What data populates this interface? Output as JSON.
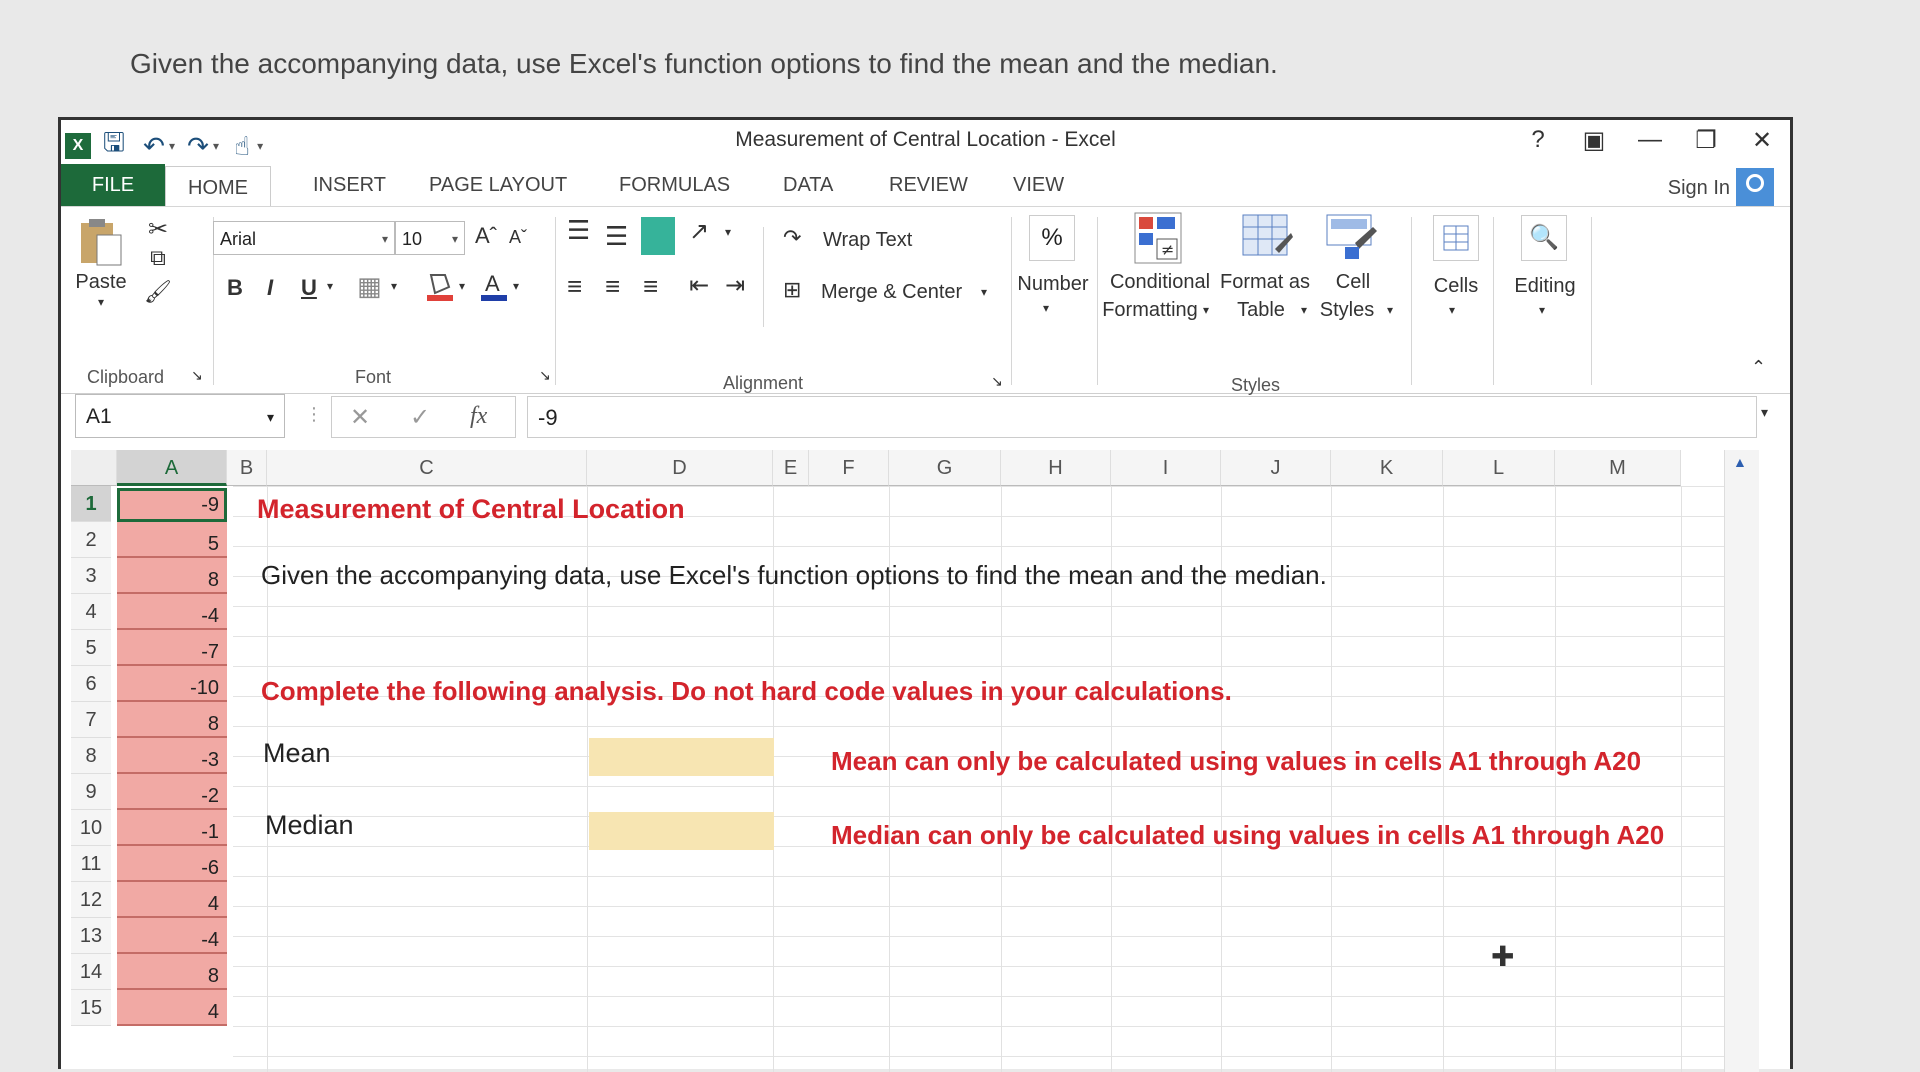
{
  "question": "Given the accompanying data, use Excel's function options to find the mean and the median.",
  "window": {
    "title": "Measurement of Central Location - Excel",
    "help": "?",
    "sign_in": "Sign In"
  },
  "tabs": [
    "FILE",
    "HOME",
    "INSERT",
    "PAGE LAYOUT",
    "FORMULAS",
    "DATA",
    "REVIEW",
    "VIEW"
  ],
  "ribbon": {
    "clipboard": {
      "paste": "Paste",
      "group": "Clipboard"
    },
    "font": {
      "name": "Arial",
      "size": "10",
      "bold": "B",
      "italic": "I",
      "underline": "U",
      "group": "Font"
    },
    "alignment": {
      "wrap_text": "Wrap Text",
      "merge_center": "Merge & Center",
      "group": "Alignment"
    },
    "number": {
      "symbol": "%",
      "label": "Number"
    },
    "styles": {
      "conditional_1": "Conditional",
      "conditional_2": "Formatting",
      "format_table_1": "Format as",
      "format_table_2": "Table",
      "cell_styles_1": "Cell",
      "cell_styles_2": "Styles",
      "group": "Styles"
    },
    "cells": "Cells",
    "editing": "Editing"
  },
  "formula_bar": {
    "name_box": "A1",
    "formula": "-9",
    "fx": "fx"
  },
  "columns": [
    "A",
    "B",
    "C",
    "D",
    "E",
    "F",
    "G",
    "H",
    "I",
    "J",
    "K",
    "L",
    "M"
  ],
  "rows": [
    "1",
    "2",
    "3",
    "4",
    "5",
    "6",
    "7",
    "8",
    "9",
    "10",
    "11",
    "12",
    "13",
    "14",
    "15"
  ],
  "column_a_values": [
    "-9",
    "5",
    "8",
    "-4",
    "-7",
    "-10",
    "8",
    "-3",
    "-2",
    "-1",
    "-6",
    "4",
    "-4",
    "8",
    "4"
  ],
  "sheet": {
    "title": "Measurement of Central Location",
    "instruction": "Given the accompanying data, use Excel's function options to find the mean and the median.",
    "complete": "Complete the following analysis. Do not hard code values in your calculations.",
    "mean_label": "Mean",
    "median_label": "Median",
    "mean_note": "Mean can only be calculated using values in cells A1 through A20",
    "median_note": "Median can only be calculated using values in cells A1 through A20"
  },
  "colors": {
    "excel_green": "#1d6a3a",
    "data_fill": "#f1a9a4",
    "input_fill": "#f7e5b2",
    "red_text": "#d3242c"
  }
}
